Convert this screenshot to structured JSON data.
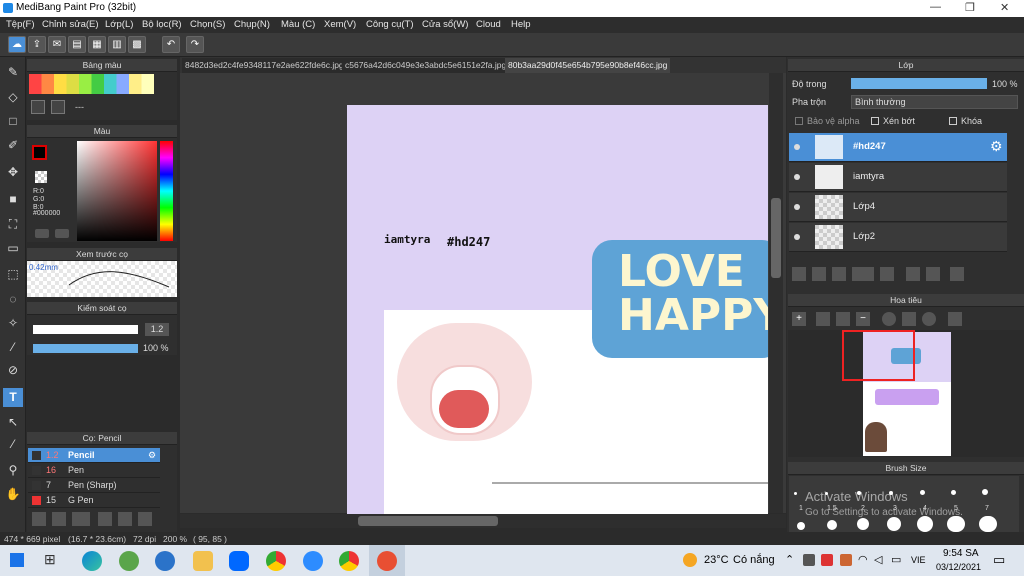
{
  "window": {
    "title": "MediBang Paint Pro (32bit)",
    "minimize": "—",
    "maximize": "❐",
    "close": "✕"
  },
  "menu": [
    "Tệp(F)",
    "Chỉnh sửa(E)",
    "Lớp(L)",
    "Bộ lọc(R)",
    "Chọn(S)",
    "Chụp(N)",
    "Màu (C)",
    "Xem(V)",
    "Công cụ(T)",
    "Cửa sổ(W)",
    "Cloud",
    "Help"
  ],
  "tabs": [
    "8482d3ed2c4fe9348117e2ae622fde6c.jpg",
    "c5676a42d6c049e3e3abdc5e6151e2fa.jpg",
    "80b3aa29d0f45e654b795e90b8ef46cc.jpg"
  ],
  "palette": {
    "title": "Bảng màu",
    "dashes": "---"
  },
  "color": {
    "title": "Màu",
    "r": "R:0",
    "g": "G:0",
    "b": "B:0",
    "hex": "#000000"
  },
  "preview": {
    "title": "Xem trước cọ",
    "size": "0.42mm"
  },
  "brush_control": {
    "title": "Kiểm soát cọ",
    "size": "1.2",
    "opacity": "100 %"
  },
  "brush_list": {
    "title": "Cọ: Pencil",
    "items": [
      {
        "size": "1.2",
        "name": "Pencil",
        "selected": true
      },
      {
        "size": "16",
        "name": "Pen",
        "selected": false
      },
      {
        "size": "7",
        "name": "Pen (Sharp)",
        "selected": false
      },
      {
        "size": "15",
        "name": "G Pen",
        "selected": false
      }
    ]
  },
  "layer_panel": {
    "title": "Lớp",
    "opacity_label": "Độ trong",
    "opacity_value": "100 %",
    "blend_label": "Pha trộn",
    "blend_value": "Bình thường",
    "protect_alpha": "Bảo vệ alpha",
    "clip": "Xén bớt",
    "lock": "Khóa",
    "layers": [
      "#hd247",
      "iamtyra",
      "Lớp4",
      "Lớp2"
    ]
  },
  "navigator": {
    "title": "Hoa tiêu"
  },
  "brush_size": {
    "title": "Brush Size",
    "sizes": [
      "1",
      "1.5",
      "2",
      "3",
      "4",
      "5",
      "7"
    ]
  },
  "canvas": {
    "text1": "iamtyra",
    "text2": "#hd247",
    "banner": "LOVE HAPPY"
  },
  "watermark": {
    "line1": "Activate Windows",
    "line2": "Go to Settings to activate Windows."
  },
  "status": {
    "size": "474 * 669 pixel",
    "cm": "(16.7 * 23.6cm)",
    "dpi": "72 dpi",
    "zoom": "200 %",
    "pos": "( 95, 85 )"
  },
  "taskbar": {
    "weather": "23°C",
    "weather_text": "Có nắng",
    "lang": "VIE",
    "time": "9:54 SA",
    "date": "03/12/2021"
  }
}
